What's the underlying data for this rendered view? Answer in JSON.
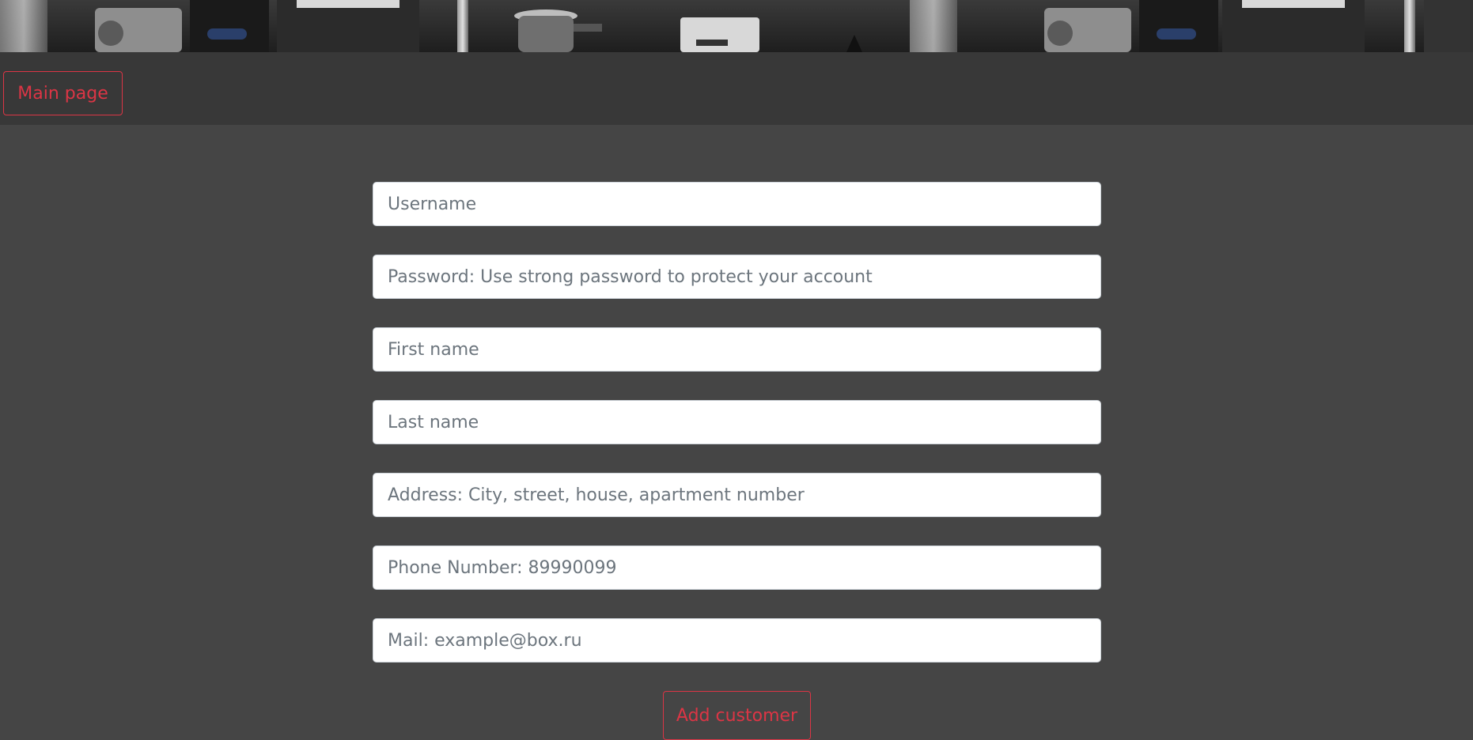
{
  "nav": {
    "main_page_label": "Main page"
  },
  "form": {
    "username_placeholder": "Username",
    "password_placeholder": "Password: Use strong password to protect your account",
    "first_name_placeholder": "First name",
    "last_name_placeholder": "Last name",
    "address_placeholder": "Address: City, street, house, apartment number",
    "phone_placeholder": "Phone Number: 89990099",
    "mail_placeholder": "Mail: example@box.ru",
    "submit_label": "Add customer"
  },
  "colors": {
    "accent": "#dc3545",
    "page_background": "#454545",
    "navbar_background": "#383838"
  }
}
